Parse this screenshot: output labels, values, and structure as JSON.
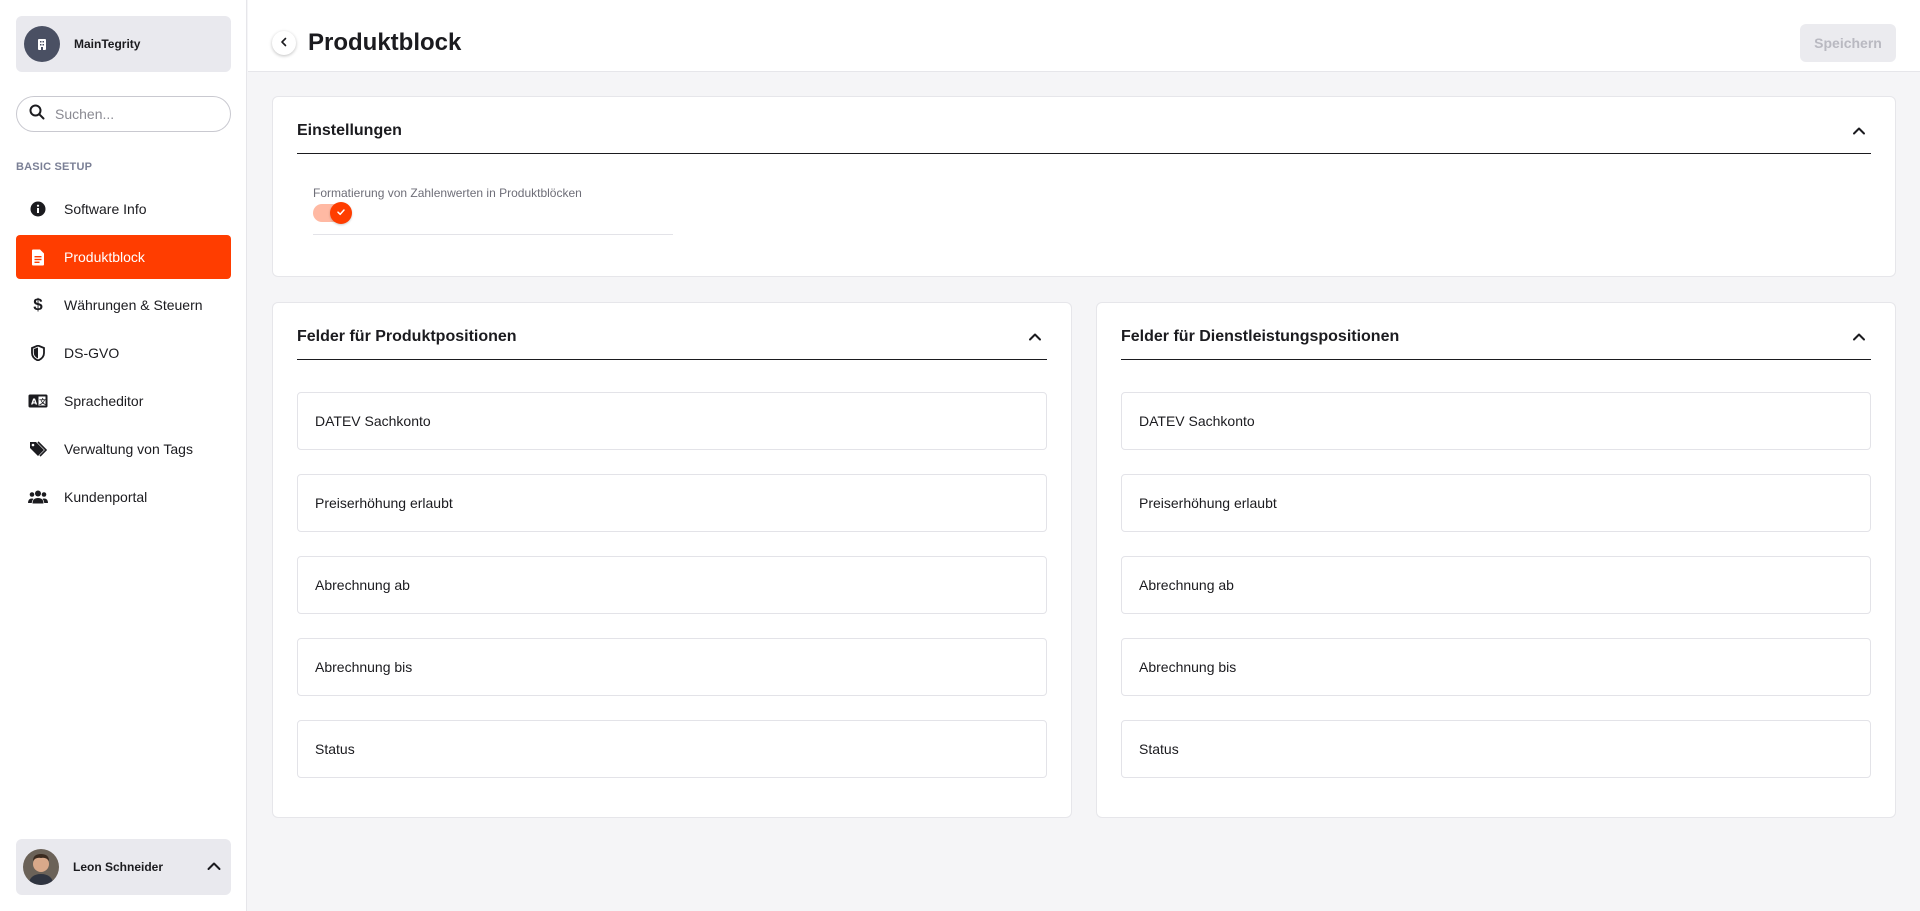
{
  "sidebar": {
    "org_name": "MainTegrity",
    "search_placeholder": "Suchen...",
    "section_label": "BASIC SETUP",
    "items": [
      {
        "label": "Software Info",
        "icon": "info-icon"
      },
      {
        "label": "Produktblock",
        "icon": "document-icon",
        "active": true
      },
      {
        "label": "Währungen & Steuern",
        "icon": "dollar-icon"
      },
      {
        "label": "DS-GVO",
        "icon": "shield-icon"
      },
      {
        "label": "Spracheditor",
        "icon": "language-icon"
      },
      {
        "label": "Verwaltung von Tags",
        "icon": "tags-icon"
      },
      {
        "label": "Kundenportal",
        "icon": "users-icon"
      }
    ],
    "user_name": "Leon Schneider"
  },
  "header": {
    "title": "Produktblock",
    "save_label": "Speichern"
  },
  "settings": {
    "title": "Einstellungen",
    "toggle_label": "Formatierung von Zahlenwerten in Produktblöcken",
    "toggle_on": true
  },
  "product_fields": {
    "title": "Felder für Produktpositionen",
    "items": [
      "DATEV Sachkonto",
      "Preiserhöhung erlaubt",
      "Abrechnung ab",
      "Abrechnung bis",
      "Status"
    ]
  },
  "service_fields": {
    "title": "Felder für Dienstleistungspositionen",
    "items": [
      "DATEV Sachkonto",
      "Preiserhöhung erlaubt",
      "Abrechnung ab",
      "Abrechnung bis",
      "Status"
    ]
  },
  "colors": {
    "accent": "#ff3d00",
    "accent_light": "#ffb9a3",
    "sidebar_card": "#e9e9ee"
  }
}
